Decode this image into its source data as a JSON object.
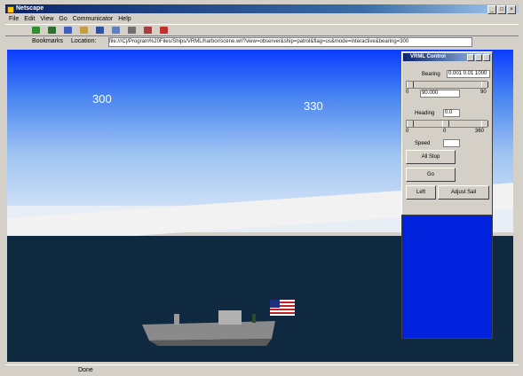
{
  "window": {
    "title": "Netscape",
    "controls": [
      "_",
      "□",
      "×"
    ]
  },
  "menu": [
    "File",
    "Edit",
    "View",
    "Go",
    "Communicator",
    "Help"
  ],
  "address": {
    "bookmarks_label": "Bookmarks",
    "location_label": "Location:",
    "url": "file:///C|/Program%20Files/Ships/VRML/harbor/scene.wrl?view=observer&ship=patrol&flag=us&mode=interactive&bearing=300"
  },
  "scene": {
    "bearing_labels": [
      "300",
      "330"
    ]
  },
  "panel": {
    "title": "VRML Control",
    "field1_label": "Bearing",
    "field1_value": "0.001 0.01 1000",
    "slider1_min": "0",
    "slider1_max": "90",
    "field2_value": "90.000",
    "field3_label": "Heading",
    "field3_value": "0.0",
    "slider2_min": "0",
    "slider2_mid": "0",
    "slider2_max": "360",
    "field4_label": "Speed",
    "field4_value": "",
    "btn_all_stop": "All Stop",
    "btn_go": "Go",
    "btn_left": "Left",
    "btn_right": "Adjust Sail"
  },
  "status": {
    "text": "Done"
  },
  "colors": {
    "sky_top": "#0a3cff",
    "water": "#0f2a40",
    "panel_blue": "#0022dd"
  }
}
